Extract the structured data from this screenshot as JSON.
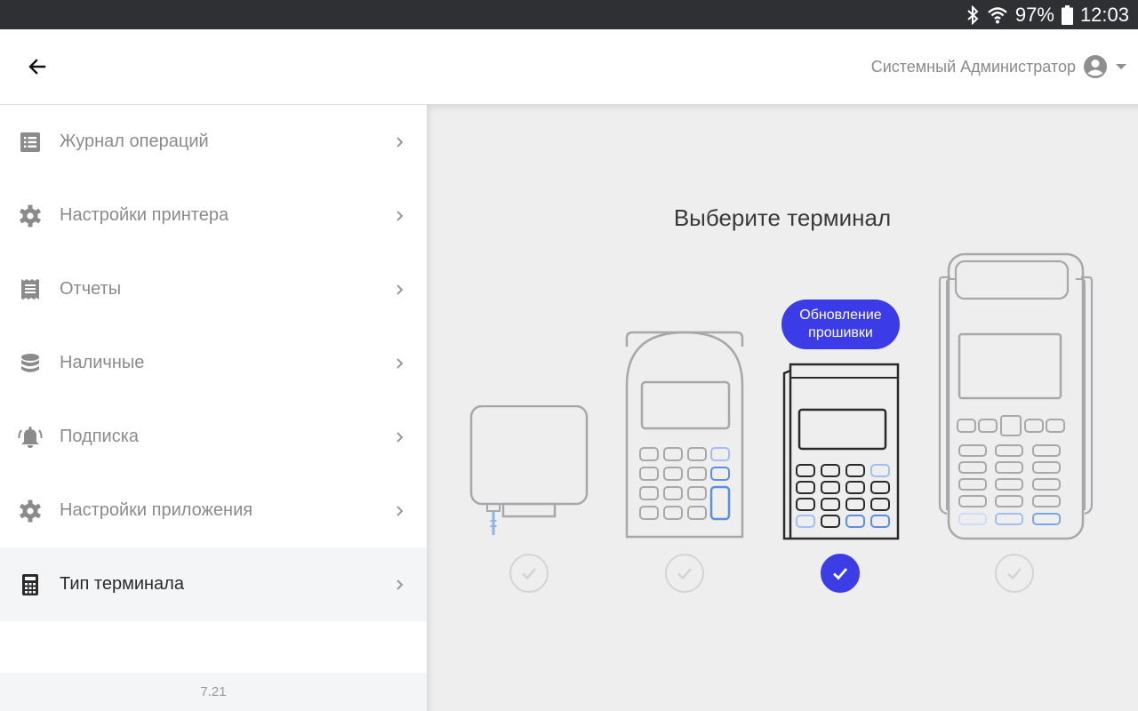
{
  "statusbar": {
    "battery": "97%",
    "time": "12:03"
  },
  "appbar": {
    "user_name": "Системный Администратор"
  },
  "sidebar": {
    "items": [
      {
        "label": "Журнал операций",
        "icon": "list-icon"
      },
      {
        "label": "Настройки принтера",
        "icon": "gear-icon"
      },
      {
        "label": "Отчеты",
        "icon": "receipt-icon"
      },
      {
        "label": "Наличные",
        "icon": "coins-stack-icon"
      },
      {
        "label": "Подписка",
        "icon": "bell-icon"
      },
      {
        "label": "Настройки приложения",
        "icon": "gear-icon"
      },
      {
        "label": "Тип терминала",
        "icon": "calculator-icon",
        "active": true
      }
    ],
    "version": "7.21"
  },
  "main": {
    "title": "Выберите терминал",
    "badge": {
      "line1": "Обновление",
      "line2": "прошивки"
    },
    "terminals": [
      {
        "id": "card-reader",
        "selected": false
      },
      {
        "id": "pinpad",
        "selected": false
      },
      {
        "id": "mini-terminal",
        "selected": true
      },
      {
        "id": "pos-terminal",
        "selected": false
      }
    ]
  },
  "colors": {
    "accent": "#3d3de6",
    "selected_item_bg": "#f4f5f7",
    "main_bg": "#eeeeef"
  }
}
